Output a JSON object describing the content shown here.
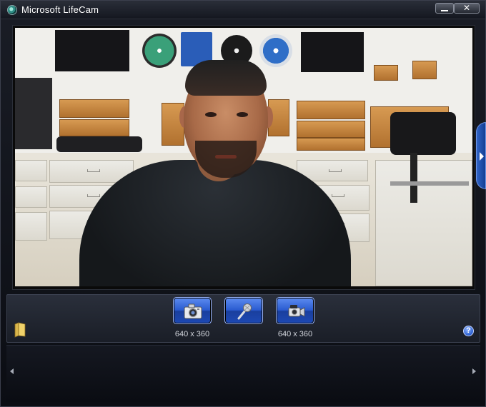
{
  "window": {
    "title": "Microsoft LifeCam"
  },
  "title_controls": {
    "minimize": "minimize",
    "close": "✕"
  },
  "controls": {
    "photo_button": "take-photo",
    "audio_button": "microphone",
    "video_button": "record-video",
    "photo_resolution": "640 x 360",
    "video_resolution": "640 x 360",
    "help": "?"
  },
  "icons": {
    "app": "lifecam-icon",
    "folder": "folder-icon",
    "help": "help-icon",
    "camera": "camera-icon",
    "mic": "microphone-icon",
    "camcorder": "camcorder-icon",
    "side_tab": "expand-panel-arrow-icon",
    "scroll_left": "scroll-left-icon",
    "scroll_right": "scroll-right-icon"
  },
  "colors": {
    "accent_blue": "#2a5bd0",
    "panel_bg": "#1a1e27"
  }
}
